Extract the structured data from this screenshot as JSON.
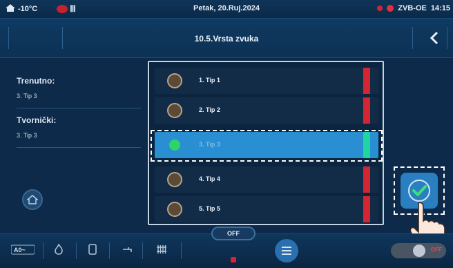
{
  "status_bar": {
    "temperature": "-10°C",
    "date": "Petak, 20.Ruj.2024",
    "controller": "ZVB-OE",
    "time": "14:15"
  },
  "title_bar": {
    "title": "10.5.Vrsta zvuka",
    "back_icon": "chevron-left-icon"
  },
  "left_panel": {
    "current_label": "Trenutno:",
    "current_value": "3. Tip 3",
    "factory_label": "Tvornički:",
    "factory_value": "3. Tip 3"
  },
  "list": {
    "items": [
      {
        "label": "1. Tip 1",
        "selected": false
      },
      {
        "label": "2. Tip 2",
        "selected": false
      },
      {
        "label": "3. Tip 3",
        "selected": true
      },
      {
        "label": "4. Tip 4",
        "selected": false
      },
      {
        "label": "5. Tip 5",
        "selected": false
      }
    ]
  },
  "bottom_bar": {
    "off_label": "OFF",
    "toggle_label": "OFF"
  },
  "colors": {
    "accent_blue": "#2a8fd2",
    "selected_green": "#2cd46a",
    "indicator_red": "#d32632",
    "indicator_teal": "#1fd6a0"
  }
}
